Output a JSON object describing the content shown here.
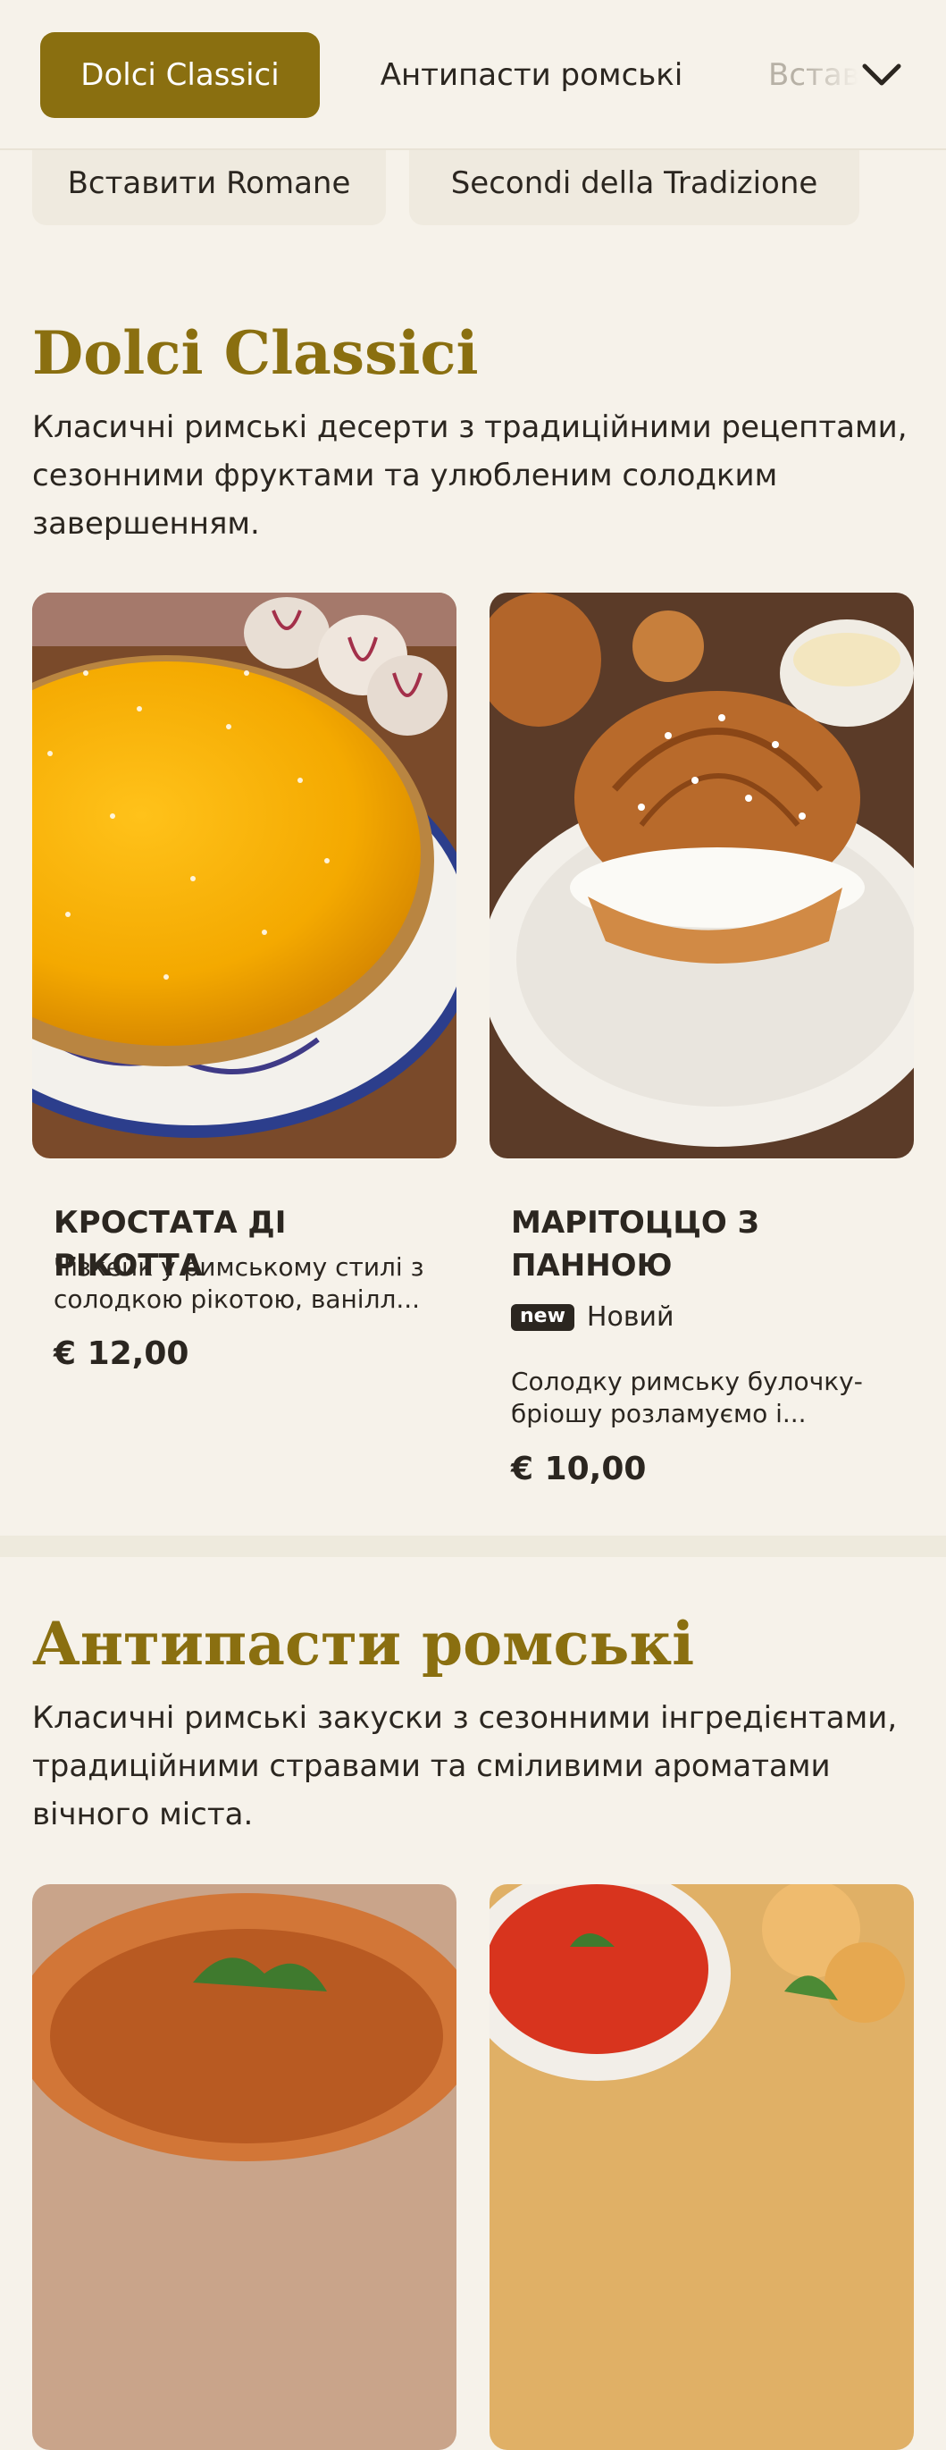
{
  "nav": {
    "tabs": [
      {
        "label": "Dolci Classici",
        "active": true
      },
      {
        "label": "Антипасти ромські",
        "active": false
      },
      {
        "label": "Вставити Romane",
        "active": false
      }
    ],
    "more_icon": "chevron-down-icon",
    "chips": [
      {
        "label": "Вставити Romane"
      },
      {
        "label": "Secondi della Tradizione"
      }
    ]
  },
  "sections": [
    {
      "title": "Dolci Classici",
      "description": "Класичні римські десерти з традиційними рецептами, сезонними фруктами та улюбленим солодким завершенням.",
      "items": [
        {
          "name": "КРОСТАТА ДІ РІКОТТА",
          "description": "Чізкейк у римському стилі з солодкою рікотою, ванілл...",
          "price": "€ 12,00"
        },
        {
          "name": "МАРІТОЦЦО З ПАННОЮ",
          "badge": "new",
          "badge_label": "Новий",
          "description": "Солодку римську булочку-бріошу розламуємо і...",
          "price": "€ 10,00"
        }
      ]
    },
    {
      "title": "Антипасти ромські",
      "description": "Класичні римські закуски з сезонними інгредієнтами, традиційними стравами та сміливими ароматами вічного міста."
    }
  ],
  "colors": {
    "accent": "#8a6f10",
    "background": "#f6f2ea",
    "text": "#2b2620"
  }
}
